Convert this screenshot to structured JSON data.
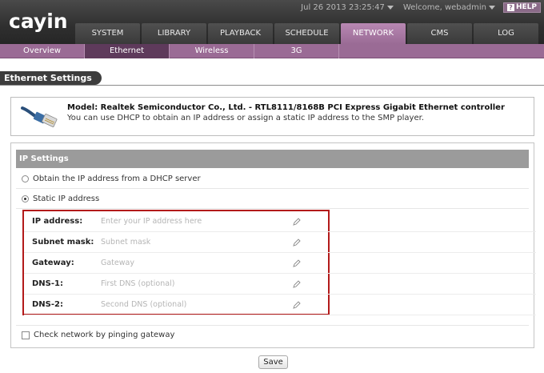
{
  "header": {
    "logo_text": "cayin",
    "datetime": "Jul 26 2013 23:25:47",
    "welcome": "Welcome, webadmin",
    "help_label": "HELP"
  },
  "main_tabs": [
    {
      "label": "SYSTEM",
      "active": false
    },
    {
      "label": "LIBRARY",
      "active": false
    },
    {
      "label": "PLAYBACK",
      "active": false
    },
    {
      "label": "SCHEDULE",
      "active": false
    },
    {
      "label": "NETWORK",
      "active": true
    },
    {
      "label": "CMS",
      "active": false
    },
    {
      "label": "LOG",
      "active": false
    }
  ],
  "sub_tabs": [
    {
      "label": "Overview",
      "active": false
    },
    {
      "label": "Ethernet",
      "active": true
    },
    {
      "label": "Wireless",
      "active": false
    },
    {
      "label": "3G",
      "active": false
    }
  ],
  "section_title": "Ethernet Settings",
  "info": {
    "model": "Model: Realtek Semiconductor Co., Ltd. - RTL8111/8168B PCI Express Gigabit Ethernet controller",
    "description": "You can use DHCP to obtain an IP address or assign a static IP address to the SMP player.",
    "icon": "ethernet-cable-icon"
  },
  "ip_settings": {
    "header": "IP Settings",
    "dhcp_label": "Obtain the IP address from a DHCP server",
    "static_label": "Static IP address",
    "dhcp_checked": false,
    "static_checked": true,
    "fields": [
      {
        "label": "IP address:",
        "value": "",
        "placeholder": "Enter your IP address here"
      },
      {
        "label": "Subnet mask:",
        "value": "",
        "placeholder": "Subnet mask"
      },
      {
        "label": "Gateway:",
        "value": "",
        "placeholder": "Gateway"
      },
      {
        "label": "DNS-1:",
        "value": "",
        "placeholder": "First DNS (optional)"
      },
      {
        "label": "DNS-2:",
        "value": "",
        "placeholder": "Second DNS (optional)"
      }
    ]
  },
  "check_network": {
    "label": "Check network by pinging gateway",
    "checked": false
  },
  "save_label": "Save",
  "colors": {
    "accent": "#9a6b95",
    "active_subtab": "#5e3a5b",
    "highlight_border": "#b31a1a",
    "header_bg": "#2f2f2f"
  }
}
